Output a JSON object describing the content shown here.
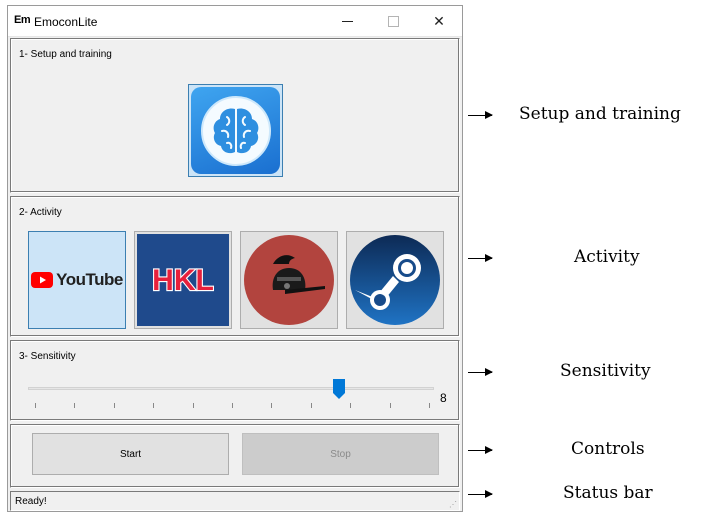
{
  "window": {
    "icon_text": "Em",
    "title": "EmoconLite",
    "close_glyph": "✕"
  },
  "setup": {
    "label": "1- Setup and training",
    "button_icon": "brain-icon"
  },
  "activity": {
    "label": "2- Activity",
    "items": [
      {
        "name": "YouTube",
        "icon": "youtube-icon",
        "text": "YouTube",
        "selected": true
      },
      {
        "name": "HKL",
        "icon": "hkl-icon",
        "text": "HKL"
      },
      {
        "name": "game",
        "icon": "knight-helmet-icon"
      },
      {
        "name": "Steam",
        "icon": "steam-icon"
      }
    ]
  },
  "sensitivity": {
    "label": "3- Sensitivity",
    "value": "8",
    "min": 0,
    "max": 10
  },
  "controls": {
    "start_label": "Start",
    "stop_label": "Stop"
  },
  "status": {
    "text": "Ready!"
  },
  "annotations": {
    "setup": "Setup and training",
    "activity": "Activity",
    "sensitivity": "Sensitivity",
    "controls": "Controls",
    "status": "Status bar"
  },
  "colors": {
    "accent": "#0078d7",
    "selection": "#cce4f7",
    "youtube_red": "#ff0000",
    "steam_blue": "#1b4a86"
  }
}
